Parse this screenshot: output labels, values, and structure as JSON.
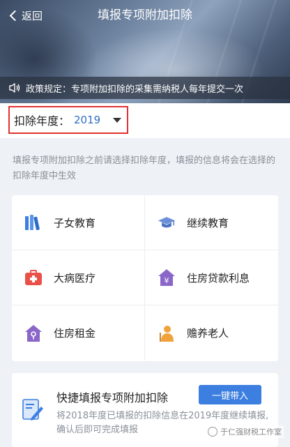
{
  "header": {
    "back_label": "返回",
    "title": "填报专项附加扣除"
  },
  "notice": {
    "text": "政策规定：专项附加扣除的采集需纳税人每年提交一次",
    "icon": "speaker-icon"
  },
  "year_selector": {
    "label": "扣除年度：",
    "value": "2019"
  },
  "hint": "填报专项附加扣除之前请选择扣除年度，填报的信息将会在选择的扣除年度中生效",
  "categories": [
    {
      "label": "子女教育",
      "icon": "books-icon",
      "color": "#3d7fe0"
    },
    {
      "label": "继续教育",
      "icon": "graduation-cap-icon",
      "color": "#6a8fd8"
    },
    {
      "label": "大病医疗",
      "icon": "medical-kit-icon",
      "color": "#e8504a"
    },
    {
      "label": "住房贷款利息",
      "icon": "house-yen-icon",
      "color": "#8a66c9"
    },
    {
      "label": "住房租金",
      "icon": "house-key-icon",
      "color": "#8a66c9"
    },
    {
      "label": "赡养老人",
      "icon": "elder-icon",
      "color": "#f0a23b"
    }
  ],
  "quick_fill": {
    "title": "快捷填报专项附加扣除",
    "button": "一键带入",
    "description": "将2018年度已填报的扣除信息在2019年度继续填报,确认后即可完成填报"
  },
  "watermark": "于仁强财税工作室"
}
